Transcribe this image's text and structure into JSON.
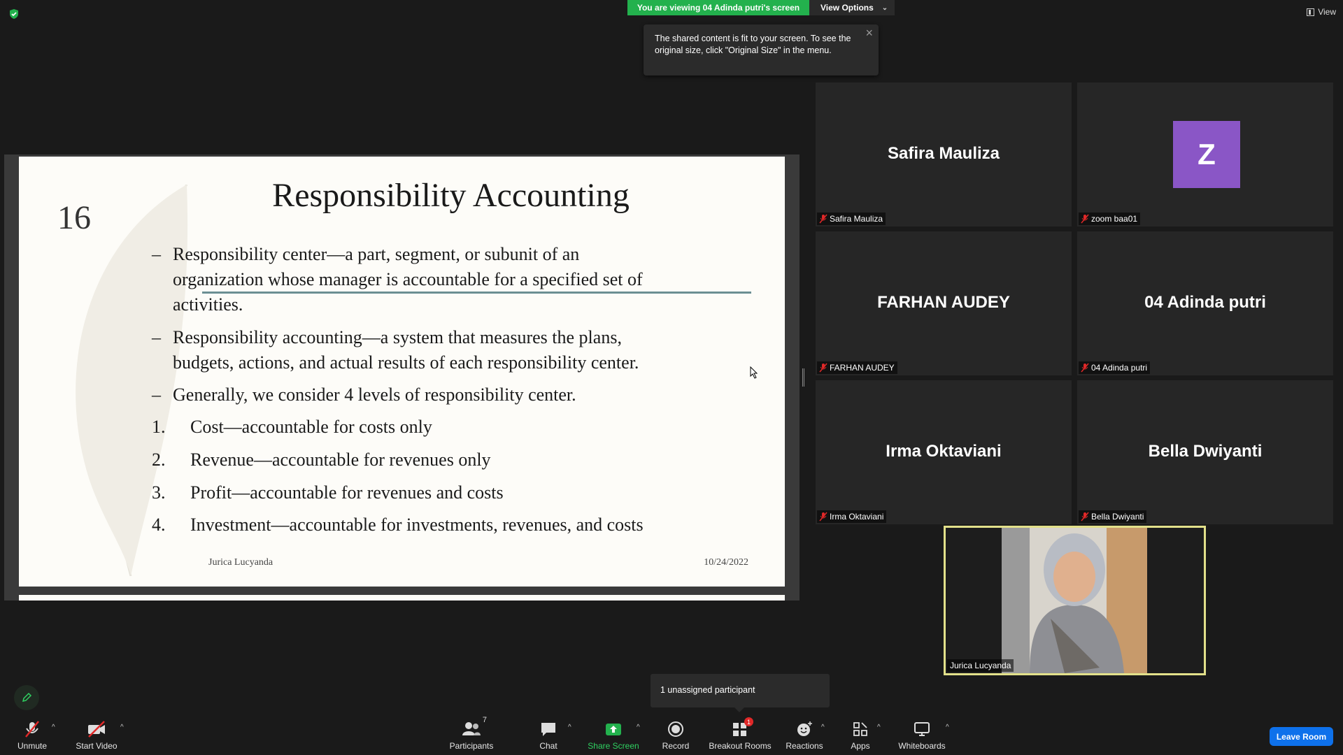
{
  "banner": {
    "viewing": "You are viewing 04 Adinda putri's screen",
    "view_options": "View Options"
  },
  "tooltip": {
    "text": "The shared content is fit to your screen. To see the original size, click \"Original Size\" in the menu."
  },
  "view_top": {
    "label": "View"
  },
  "slide": {
    "number": "16",
    "title": "Responsibility Accounting",
    "bullets": [
      {
        "dash": "–",
        "lines": [
          "Responsibility center—a part, segment, or subunit of an",
          "organization whose manager is accountable for a specified set of",
          "activities."
        ]
      },
      {
        "dash": "–",
        "lines": [
          "Responsibility accounting—a system that measures the plans,",
          "budgets, actions, and actual results of each responsibility center."
        ]
      },
      {
        "dash": "–",
        "lines": [
          "Generally, we consider 4 levels of responsibility center."
        ]
      }
    ],
    "levels": [
      {
        "n": "1.",
        "text": "Cost—accountable for costs only"
      },
      {
        "n": "2.",
        "text": "Revenue—accountable for revenues only"
      },
      {
        "n": "3.",
        "text": "Profit—accountable for revenues and costs"
      },
      {
        "n": "4.",
        "text": "Investment—accountable for investments, revenues, and costs"
      }
    ],
    "footer_author": "Jurica Lucyanda",
    "footer_date": "10/24/2022"
  },
  "participants": [
    {
      "display": "Safira Mauliza",
      "label": "Safira Mauliza"
    },
    {
      "display": "Z",
      "label": "zoom baa01"
    },
    {
      "display": "FARHAN AUDEY",
      "label": "FARHAN AUDEY"
    },
    {
      "display": "04 Adinda putri",
      "label": "04 Adinda putri"
    },
    {
      "display": "Irma Oktaviani",
      "label": "Irma Oktaviani"
    },
    {
      "display": "Bella Dwiyanti",
      "label": "Bella Dwiyanti"
    }
  ],
  "speaker": {
    "label": "Jurica Lucyanda"
  },
  "breakout_popup": {
    "text": "1 unassigned participant"
  },
  "toolbar": {
    "unmute": "Unmute",
    "start_video": "Start Video",
    "participants": "Participants",
    "participants_count": "7",
    "chat": "Chat",
    "share_screen": "Share Screen",
    "record": "Record",
    "breakout_rooms": "Breakout Rooms",
    "breakout_badge": "1",
    "reactions": "Reactions",
    "apps": "Apps",
    "whiteboards": "Whiteboards",
    "leave": "Leave Room"
  },
  "colors": {
    "share_green": "#23b14d",
    "leave_blue": "#0e71eb",
    "speaker_border": "#e2e08a",
    "avatar_purple": "#8a56c6"
  }
}
